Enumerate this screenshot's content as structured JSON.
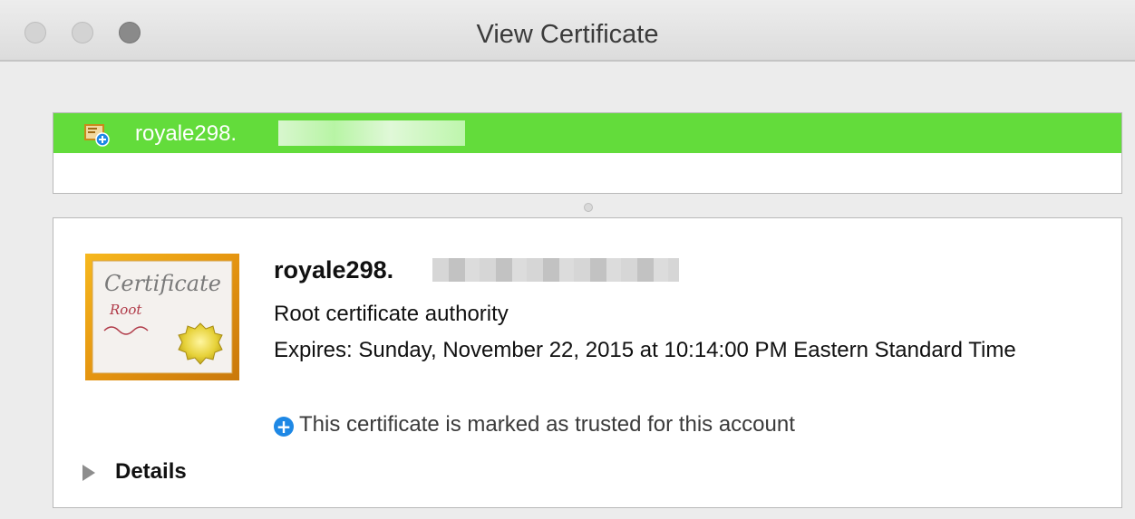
{
  "window": {
    "title": "View Certificate"
  },
  "cert_list": {
    "selected_row_label": "royale298.",
    "selected_row_color": "#63dc3b"
  },
  "cert_detail": {
    "name": "royale298.",
    "type": "Root certificate authority",
    "expiry": "Expires: Sunday, November 22, 2015 at 10:14:00 PM Eastern Standard Time",
    "trust_status": "This certificate is marked as trusted for this account",
    "trust_icon": "plus-circle-icon",
    "badge_text": "Certificate",
    "badge_subtext": "Root",
    "details_label": "Details"
  },
  "colors": {
    "selection": "#63dc3b",
    "trust_icon": "#1e88e5"
  }
}
